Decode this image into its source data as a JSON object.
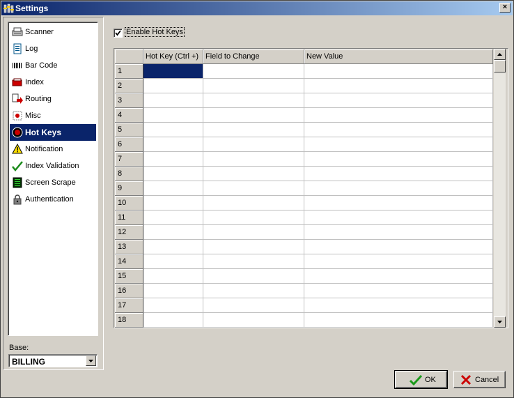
{
  "window": {
    "title": "Settings",
    "close_symbol": "×"
  },
  "sidebar": {
    "items": [
      {
        "label": "Scanner",
        "icon": "scanner-icon"
      },
      {
        "label": "Log",
        "icon": "log-icon"
      },
      {
        "label": "Bar Code",
        "icon": "barcode-icon"
      },
      {
        "label": "Index",
        "icon": "index-icon"
      },
      {
        "label": "Routing",
        "icon": "routing-icon"
      },
      {
        "label": "Misc",
        "icon": "misc-icon"
      },
      {
        "label": "Hot Keys",
        "icon": "hot-keys-icon",
        "selected": true
      },
      {
        "label": "Notification",
        "icon": "warning-icon"
      },
      {
        "label": "Index Validation",
        "icon": "checkmark-icon"
      },
      {
        "label": "Screen Scrape",
        "icon": "screen-scrape-icon"
      },
      {
        "label": "Authentication",
        "icon": "lock-icon"
      }
    ],
    "selected_index": 6
  },
  "base": {
    "label": "Base:",
    "value": "BILLING"
  },
  "hotkeys": {
    "enable_label": "Enable Hot Keys",
    "enabled": true
  },
  "grid": {
    "columns": [
      "Hot Key (Ctrl +)",
      "Field to Change",
      "New Value"
    ],
    "row_numbers": [
      "1",
      "2",
      "3",
      "4",
      "5",
      "6",
      "7",
      "8",
      "9",
      "10",
      "11",
      "12",
      "13",
      "14",
      "15",
      "16",
      "17",
      "18"
    ],
    "selected_row": 1,
    "selected_column": 1
  },
  "buttons": {
    "ok": "OK",
    "cancel": "Cancel"
  },
  "colors": {
    "selection": "#0a246a",
    "face": "#d4d0c8",
    "ok_check": "#1a9a1a",
    "cancel_x": "#cc0000"
  }
}
